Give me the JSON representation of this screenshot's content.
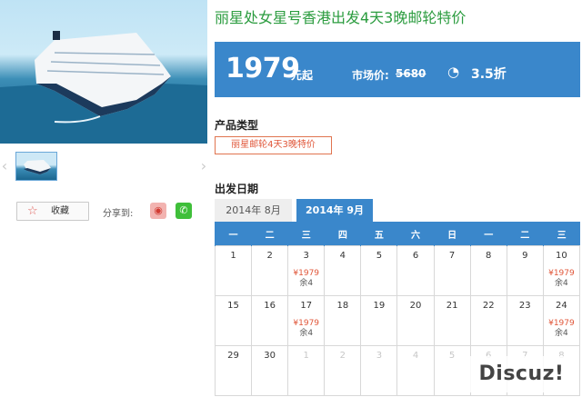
{
  "product": {
    "title": "丽星处女星号香港出发4天3晚邮轮特价"
  },
  "price": {
    "amount": "1979",
    "unit": "元起",
    "market_label": "市场价:",
    "market_value": "5680",
    "discount": "3.5折"
  },
  "gallery": {
    "prev_arrow": "‹",
    "next_arrow": "›"
  },
  "actions": {
    "favorite_label": "收藏",
    "share_label": "分享到:"
  },
  "product_type": {
    "label": "产品类型",
    "option": "丽星邮轮4天3晚特价"
  },
  "departure": {
    "label": "出发日期",
    "tabs": [
      "2014年 8月",
      "2014年 9月"
    ],
    "selected_tab": "2014年 9月"
  },
  "calendar": {
    "weekdays": [
      "一",
      "二",
      "三",
      "四",
      "五",
      "六",
      "日",
      "一",
      "二",
      "三"
    ],
    "rows": [
      [
        {
          "day": "1"
        },
        {
          "day": "2"
        },
        {
          "day": "3",
          "price": "¥1979",
          "remain": "余4"
        },
        {
          "day": "4"
        },
        {
          "day": "5"
        },
        {
          "day": "6"
        },
        {
          "day": "7"
        },
        {
          "day": "8"
        },
        {
          "day": "9"
        },
        {
          "day": "10",
          "price": "¥1979",
          "remain": "余4"
        }
      ],
      [
        {
          "day": "15"
        },
        {
          "day": "16"
        },
        {
          "day": "17",
          "price": "¥1979",
          "remain": "余4"
        },
        {
          "day": "18"
        },
        {
          "day": "19"
        },
        {
          "day": "20"
        },
        {
          "day": "21"
        },
        {
          "day": "22"
        },
        {
          "day": "23"
        },
        {
          "day": "24",
          "price": "¥1979",
          "remain": "余4"
        }
      ],
      [
        {
          "day": "29"
        },
        {
          "day": "30"
        },
        {
          "day": "1",
          "other": true
        },
        {
          "day": "2",
          "other": true
        },
        {
          "day": "3",
          "other": true
        },
        {
          "day": "4",
          "other": true
        },
        {
          "day": "5",
          "other": true
        },
        {
          "day": "6",
          "other": true
        },
        {
          "day": "7",
          "other": true
        },
        {
          "day": "8",
          "other": true
        }
      ]
    ]
  },
  "watermark": "Discuz!",
  "colors": {
    "accent": "#3a87cb",
    "title_green": "#2b9c3f",
    "price_red": "#e0573a"
  }
}
